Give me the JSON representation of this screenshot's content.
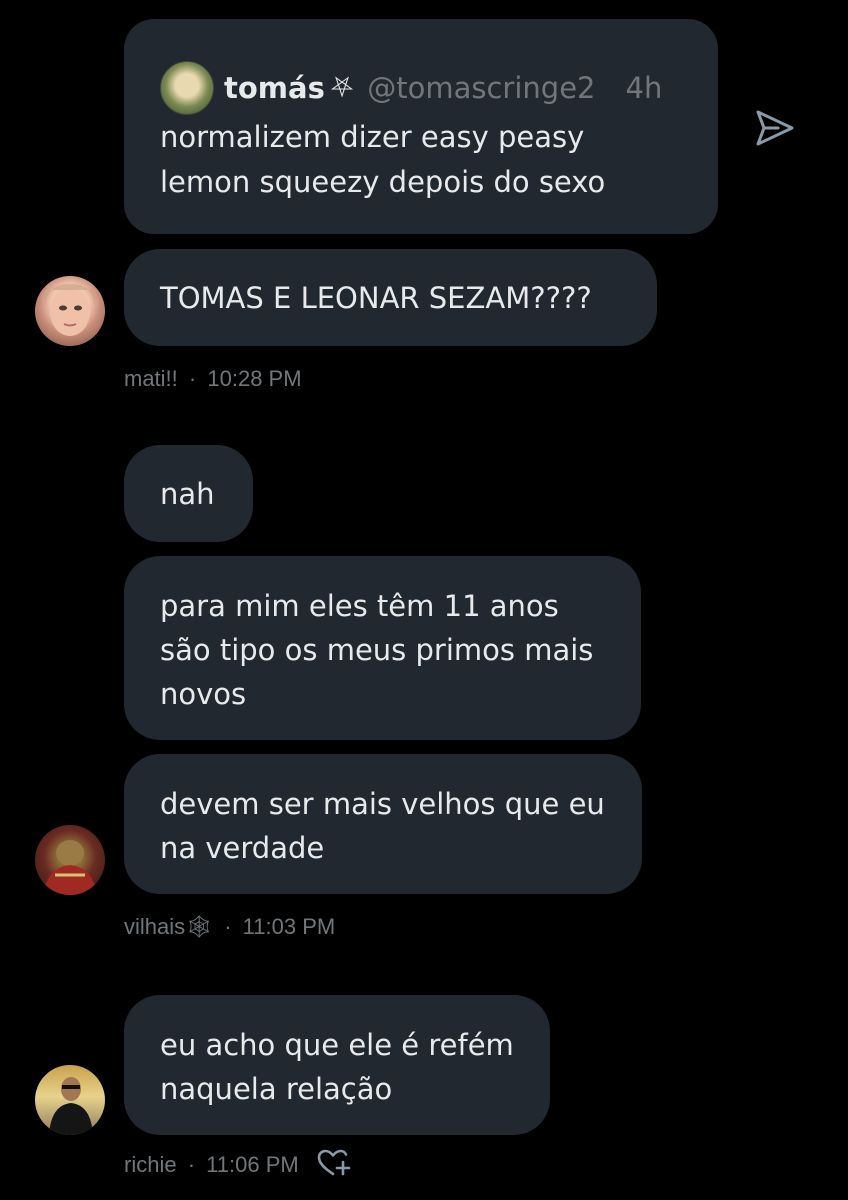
{
  "quoted_tweet": {
    "author_name": "tomás",
    "badge": "⛧",
    "handle": "@tomascringe2",
    "separator": "·",
    "time": "4h",
    "text_lines": [
      "normalizem dizer easy peasy",
      "lemon squeezy depois do sexo"
    ]
  },
  "messages": [
    {
      "lines": [
        "TOMAS E LEONAR SEZAM????"
      ]
    },
    {
      "lines": [
        "nah"
      ]
    },
    {
      "lines": [
        "para mim eles têm 11 anos",
        "são tipo os meus primos mais",
        "novos"
      ]
    },
    {
      "lines": [
        "devem ser mais velhos que eu",
        "na verdade"
      ]
    },
    {
      "lines": [
        "eu acho que ele é refém",
        "naquela relação"
      ]
    }
  ],
  "meta": [
    {
      "sender": "mati!!",
      "separator": "·",
      "time": "10:28 PM"
    },
    {
      "sender": "vilhais🕸",
      "separator": "·",
      "time": "11:03 PM"
    },
    {
      "sender": "richie",
      "separator": "·",
      "time": "11:06 PM"
    }
  ],
  "icons": {
    "share": "share-icon",
    "add_reaction": "add-reaction-icon"
  }
}
